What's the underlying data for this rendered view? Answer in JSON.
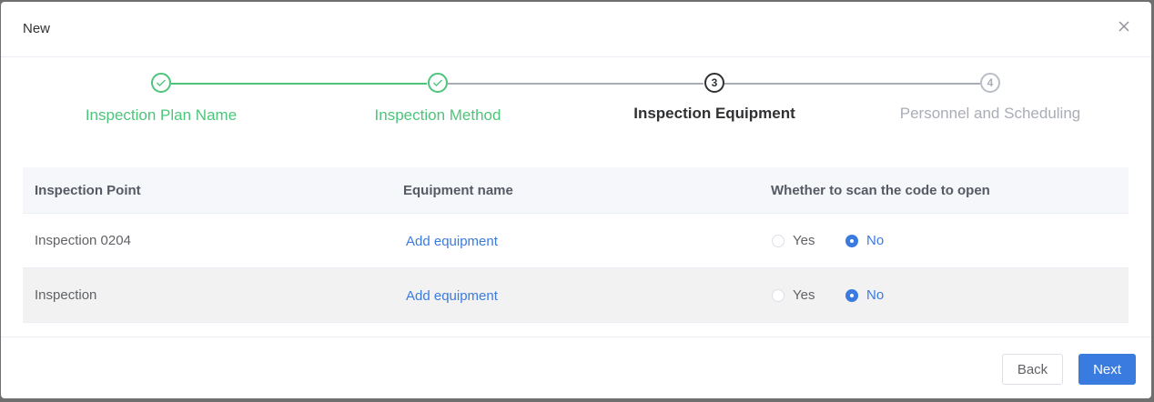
{
  "dialog": {
    "title": "New"
  },
  "steps": [
    {
      "label": "Inspection Plan Name",
      "number": "1",
      "status": "done"
    },
    {
      "label": "Inspection Method",
      "number": "2",
      "status": "done"
    },
    {
      "label": "Inspection Equipment",
      "number": "3",
      "status": "active"
    },
    {
      "label": "Personnel and Scheduling",
      "number": "4",
      "status": "pending"
    }
  ],
  "table": {
    "columns": [
      "Inspection Point",
      "Equipment name",
      "Whether to scan the code to open"
    ],
    "rows": [
      {
        "point": "Inspection 0204",
        "equipment_action": "Add equipment",
        "yes_label": "Yes",
        "no_label": "No",
        "selected": "No"
      },
      {
        "point": "Inspection",
        "equipment_action": "Add equipment",
        "yes_label": "Yes",
        "no_label": "No",
        "selected": "No"
      }
    ]
  },
  "footer": {
    "back_label": "Back",
    "next_label": "Next"
  },
  "colors": {
    "accent": "#3a7be0",
    "done": "#4cc57a",
    "pending": "#a8adb6"
  }
}
